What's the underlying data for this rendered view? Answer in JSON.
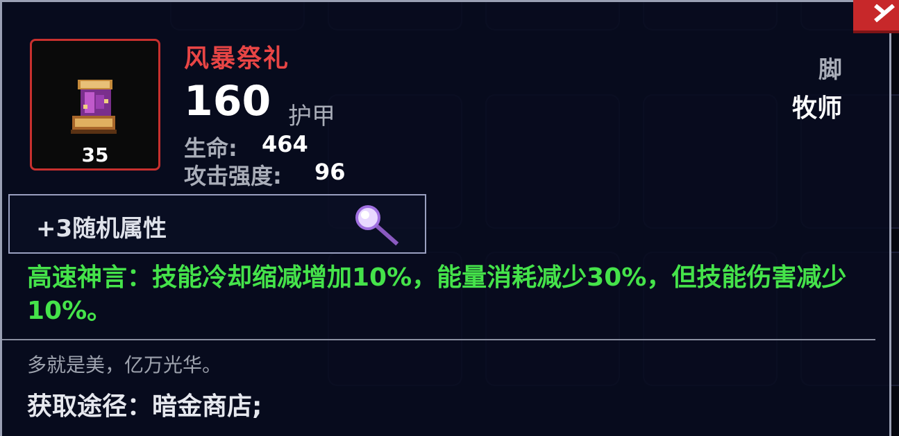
{
  "item": {
    "name": "风暴祭礼",
    "level": "35",
    "armor_value": "160",
    "armor_label": "护甲",
    "slot": "脚",
    "class": "牧师",
    "stats": [
      {
        "name": "生命:",
        "value": "464"
      },
      {
        "name": "攻击强度:",
        "value": "96"
      }
    ],
    "icon": "boot-icon",
    "rarity_color": "#e84545"
  },
  "random_attributes": {
    "label": "+3随机属性",
    "icon": "magnifier-icon"
  },
  "effect": {
    "text": "高速神言：技能冷却缩减增加10%，能量消耗减少30%，但技能伤害减少10%。",
    "color": "#45e34a"
  },
  "flavor_text": "多就是美，亿万光华。",
  "source_text": "获取途径：暗金商店;",
  "close": {
    "icon": "close-icon"
  }
}
